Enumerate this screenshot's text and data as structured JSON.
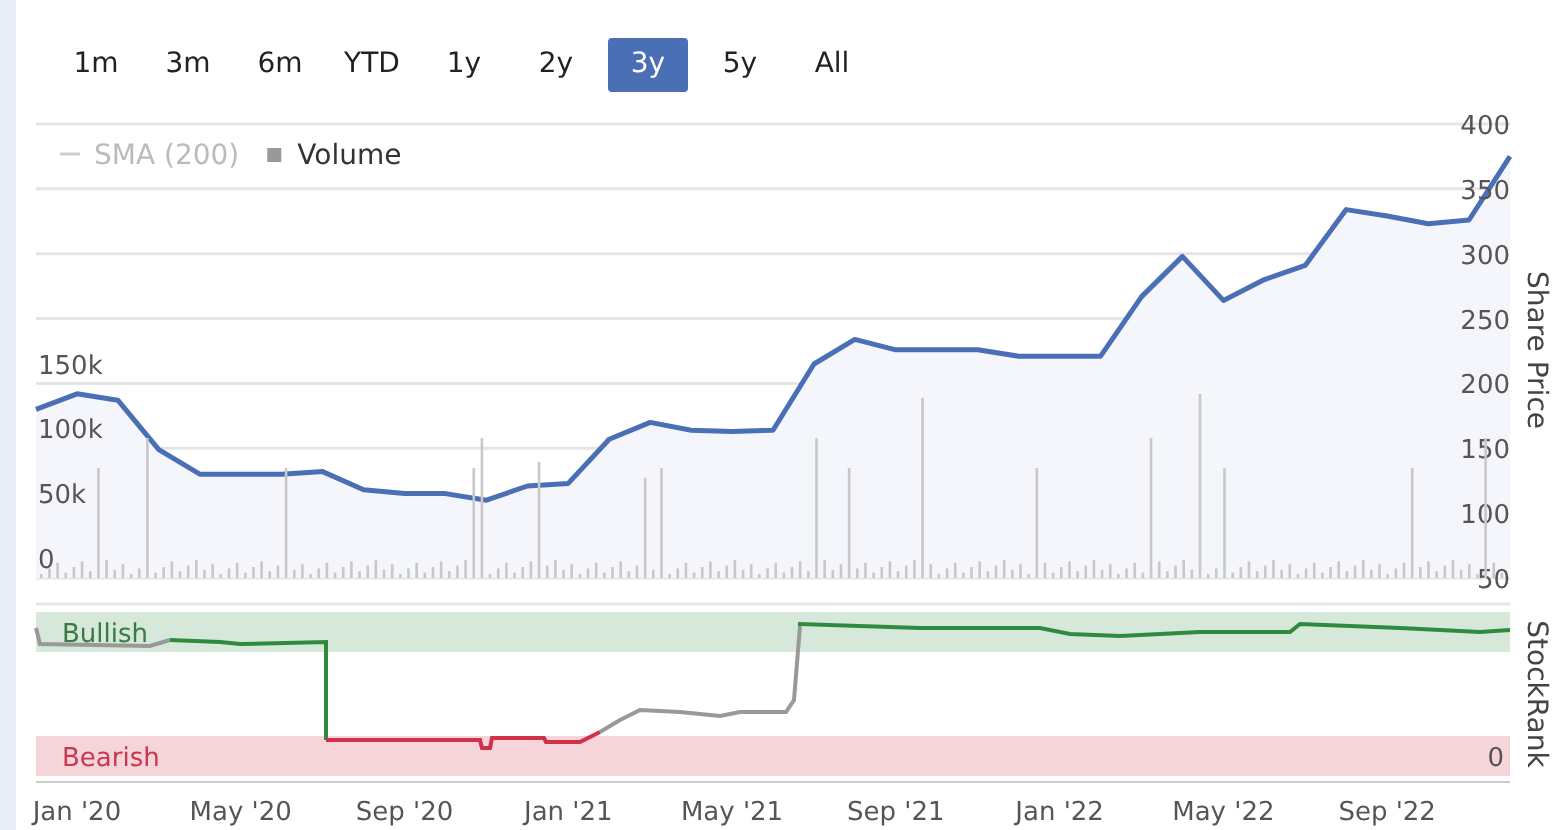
{
  "range_buttons": [
    {
      "label": "1m",
      "selected": false
    },
    {
      "label": "3m",
      "selected": false
    },
    {
      "label": "6m",
      "selected": false
    },
    {
      "label": "YTD",
      "selected": false
    },
    {
      "label": "1y",
      "selected": false
    },
    {
      "label": "2y",
      "selected": false
    },
    {
      "label": "3y",
      "selected": true
    },
    {
      "label": "5y",
      "selected": false
    },
    {
      "label": "All",
      "selected": false
    }
  ],
  "legend": [
    {
      "kind": "line",
      "label": "SMA (200)",
      "visible": false
    },
    {
      "kind": "square",
      "label": "Volume",
      "visible": true
    }
  ],
  "price_panel": {
    "chart_data": {
      "type": "line",
      "ylabel": "Share Price",
      "categories": [
        null,
        null,
        null,
        null,
        null,
        null,
        null,
        null,
        null,
        null,
        null,
        null,
        null,
        null,
        null,
        null,
        null,
        null,
        null,
        null,
        null,
        null,
        null,
        null,
        null,
        null,
        null,
        null,
        null,
        null,
        null,
        null,
        null,
        null,
        null,
        null,
        null
      ],
      "series": [
        {
          "color": "#4a6fb5",
          "values": [
            180,
            192,
            187,
            149,
            130,
            130,
            130,
            132,
            118,
            115,
            115,
            110,
            121,
            123,
            157,
            170,
            164,
            163,
            164,
            215,
            234,
            226,
            226,
            226,
            221,
            221,
            221,
            267,
            298,
            264,
            280,
            291,
            334,
            329,
            323,
            326,
            375
          ]
        }
      ],
      "ylim": [
        50,
        400
      ],
      "yticks": [
        50,
        100,
        150,
        200,
        250,
        300,
        350,
        400
      ]
    }
  },
  "volume_axis_labels": [
    "150k",
    "100k",
    "50k",
    "0"
  ],
  "date_axis_labels": [
    "Jan '20",
    "May '20",
    "Sep '20",
    "Jan '21",
    "May '21",
    "Sep '21",
    "Jan '22",
    "May '22",
    "Sep '22"
  ],
  "stockrank_panel": {
    "axis_title": "StockRank",
    "bands": [
      {
        "kind": "bullish",
        "label": "Bullish"
      },
      {
        "kind": "bearish",
        "label": "Bearish"
      }
    ],
    "min_label": "0"
  }
}
